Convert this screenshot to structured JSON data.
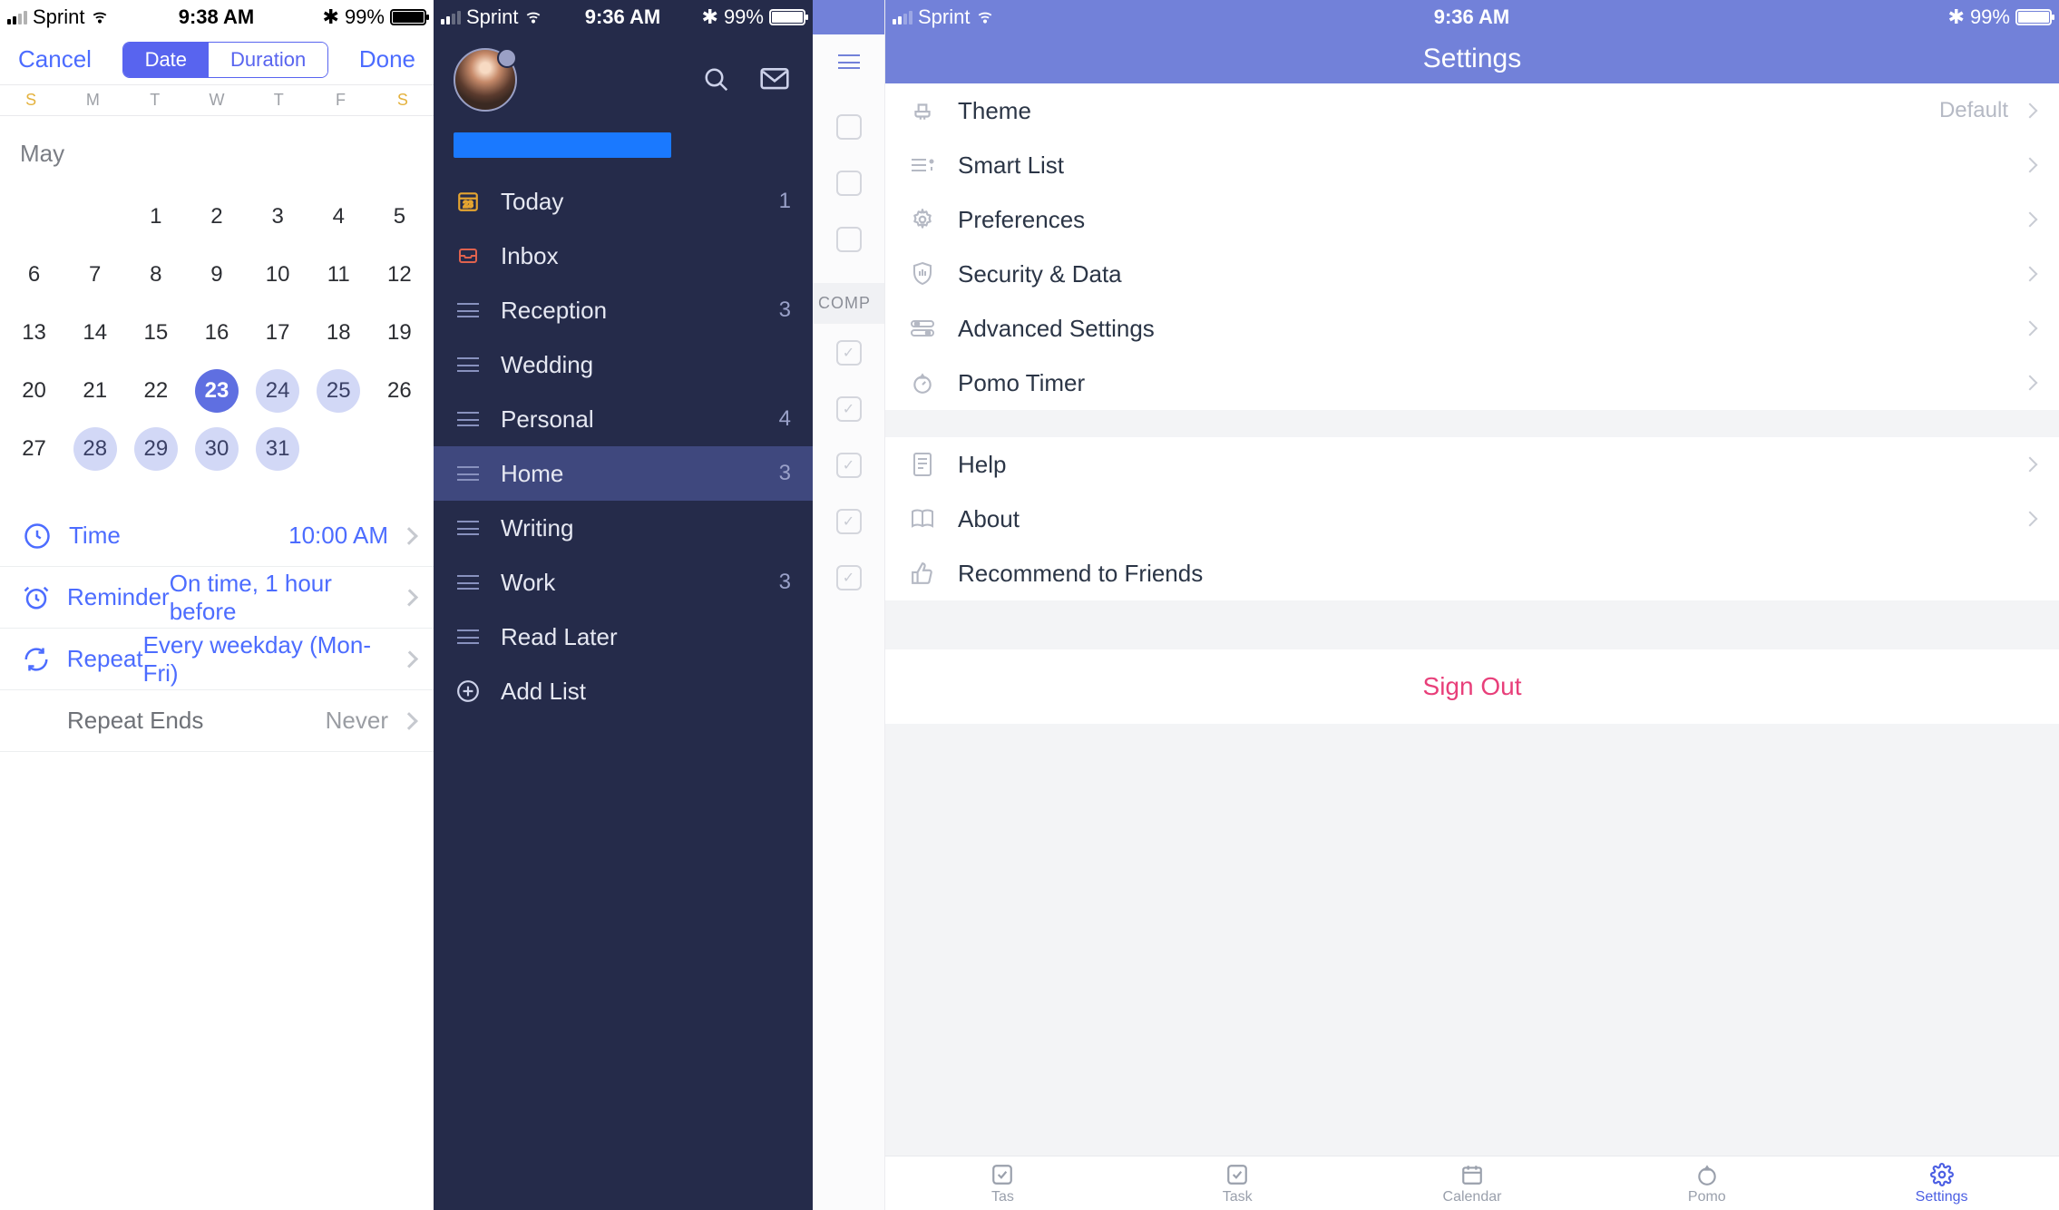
{
  "colors": {
    "accent_blue": "#5864ef",
    "link_blue": "#4c6cff",
    "sidebar_bg": "#252b4a",
    "sidebar_active": "#3f487e",
    "settings_header": "#7281d9",
    "signout_pink": "#e83f7a",
    "weekend_gold": "#e4b23e"
  },
  "screen1": {
    "status": {
      "carrier": "Sprint",
      "time": "9:38 AM",
      "battery": "99%"
    },
    "nav": {
      "cancel": "Cancel",
      "done": "Done",
      "segments": [
        "Date",
        "Duration"
      ],
      "active_segment": 0
    },
    "weekdays": [
      "S",
      "M",
      "T",
      "W",
      "T",
      "F",
      "S"
    ],
    "month": "May",
    "grid": [
      [
        "",
        "",
        "1",
        "2",
        "3",
        "4",
        "5"
      ],
      [
        "6",
        "7",
        "8",
        "9",
        "10",
        "11",
        "12"
      ],
      [
        "13",
        "14",
        "15",
        "16",
        "17",
        "18",
        "19"
      ],
      [
        "20",
        "21",
        "22",
        "23",
        "24",
        "25",
        "26"
      ],
      [
        "27",
        "28",
        "29",
        "30",
        "31",
        "",
        ""
      ]
    ],
    "selected": "23",
    "highlighted": [
      "24",
      "25",
      "28",
      "29",
      "30",
      "31"
    ],
    "options": [
      {
        "icon": "clock",
        "label": "Time",
        "value": "10:00 AM"
      },
      {
        "icon": "alarm",
        "label": "Reminder",
        "value": "On time, 1 hour before"
      },
      {
        "icon": "repeat",
        "label": "Repeat",
        "value": "Every weekday (Mon-Fri)"
      },
      {
        "icon": "",
        "label": "Repeat Ends",
        "value": "Never",
        "muted": true
      }
    ]
  },
  "screen2": {
    "status": {
      "carrier": "Sprint",
      "time": "9:36 AM",
      "battery": "99%"
    },
    "items": [
      {
        "icon": "calendar-today",
        "label": "Today",
        "count": "1"
      },
      {
        "icon": "inbox",
        "label": "Inbox",
        "count": ""
      },
      {
        "icon": "list",
        "label": "Reception",
        "count": "3"
      },
      {
        "icon": "list",
        "label": "Wedding",
        "count": ""
      },
      {
        "icon": "list",
        "label": "Personal",
        "count": "4"
      },
      {
        "icon": "list",
        "label": "Home",
        "count": "3",
        "active": true
      },
      {
        "icon": "list",
        "label": "Writing",
        "count": ""
      },
      {
        "icon": "list",
        "label": "Work",
        "count": "3"
      },
      {
        "icon": "list",
        "label": "Read Later",
        "count": ""
      },
      {
        "icon": "add",
        "label": "Add List",
        "count": ""
      }
    ]
  },
  "screen3": {
    "status": {
      "carrier": "Sprint",
      "time": "9:36 AM",
      "battery": "99%"
    },
    "title": "Settings",
    "peek_section_label": "COMP",
    "groups": [
      [
        {
          "icon": "theme",
          "label": "Theme",
          "value": "Default"
        },
        {
          "icon": "smartlist",
          "label": "Smart List",
          "value": ""
        },
        {
          "icon": "gear",
          "label": "Preferences",
          "value": ""
        },
        {
          "icon": "shield",
          "label": "Security & Data",
          "value": ""
        },
        {
          "icon": "sliders",
          "label": "Advanced Settings",
          "value": ""
        },
        {
          "icon": "pomo",
          "label": "Pomo Timer",
          "value": ""
        }
      ],
      [
        {
          "icon": "help",
          "label": "Help",
          "value": ""
        },
        {
          "icon": "book",
          "label": "About",
          "value": ""
        },
        {
          "icon": "thumbsup",
          "label": "Recommend to Friends",
          "value": "",
          "nochev": true
        }
      ]
    ],
    "signout": "Sign Out",
    "tabs": [
      {
        "icon": "check",
        "label": "Tas"
      },
      {
        "icon": "check",
        "label": "Task"
      },
      {
        "icon": "calendar",
        "label": "Calendar"
      },
      {
        "icon": "pomo",
        "label": "Pomo"
      },
      {
        "icon": "gear",
        "label": "Settings",
        "active": true
      }
    ]
  }
}
